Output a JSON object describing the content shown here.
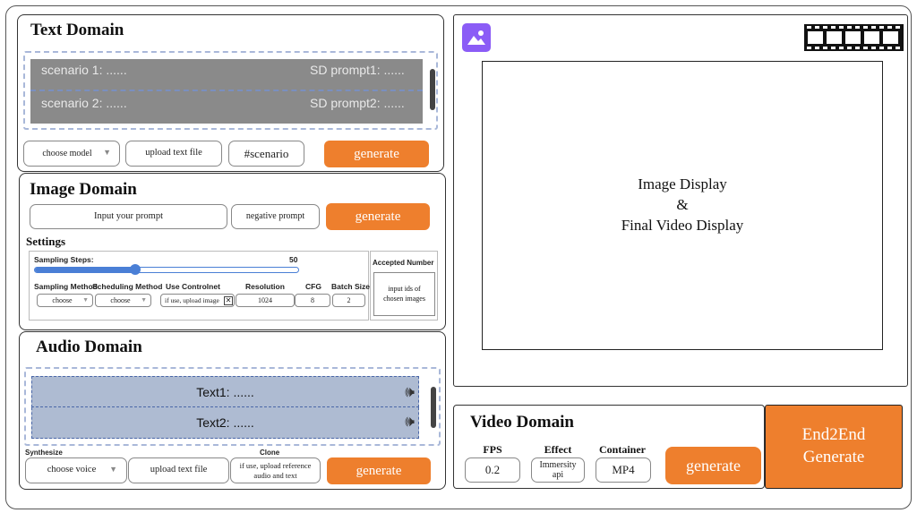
{
  "text_domain": {
    "title": "Text Domain",
    "rows": [
      {
        "scenario": "scenario 1: ......",
        "prompt": "SD prompt1: ......"
      },
      {
        "scenario": "scenario 2: ......",
        "prompt": "SD prompt2: ......"
      }
    ],
    "choose_model": "choose model",
    "upload": "upload text file",
    "scenario_field": "#scenario",
    "generate": "generate"
  },
  "image_domain": {
    "title": "Image Domain",
    "prompt_placeholder": "Input your prompt",
    "negative_placeholder": "negative prompt",
    "generate": "generate",
    "settings_title": "Settings",
    "sampling_steps_label": "Sampling Steps:",
    "sampling_steps_value": "50",
    "sampling_steps_fraction": 0.38,
    "columns": {
      "sampling_method": {
        "label": "Sampling Method",
        "value": "choose"
      },
      "scheduling_method": {
        "label": "Scheduling Method",
        "value": "choose"
      },
      "use_controlnet": {
        "label": "Use Controlnet",
        "value": "if use, upload image"
      },
      "resolution": {
        "label": "Resolution",
        "value": "1024"
      },
      "cfg": {
        "label": "CFG",
        "value": "8"
      },
      "batch_size": {
        "label": "Batch Size",
        "value": "2"
      }
    },
    "accepted_number_label": "Accepted Number",
    "accepted_number_placeholder": "input ids of chosen images"
  },
  "audio_domain": {
    "title": "Audio Domain",
    "rows": [
      "Text1: ......",
      "Text2: ......"
    ],
    "synthesize_label": "Synthesize",
    "choose_voice": "choose voice",
    "upload": "upload text file",
    "clone_label": "Clone",
    "clone_placeholder": "if use, upload reference audio and text",
    "generate": "generate"
  },
  "display": {
    "line1": "Image Display",
    "line2": "&",
    "line3": "Final Video Display"
  },
  "video_domain": {
    "title": "Video Domain",
    "fps_label": "FPS",
    "fps_value": "0.2",
    "effect_label": "Effect",
    "effect_value": "Immersity api",
    "container_label": "Container",
    "container_value": "MP4",
    "generate": "generate"
  },
  "end2end": {
    "line1": "End2End",
    "line2": "Generate"
  },
  "icons": {
    "image": "image-icon",
    "film": "film-strip-icon",
    "speaker": "speaker-icon",
    "dropdown": "chevron-down-icon",
    "close": "close-icon"
  },
  "colors": {
    "accent_orange": "#ee7f2d",
    "audio_row": "#aebbd2",
    "text_row": "#8a8a8a",
    "image_icon": "#8b5cf6"
  }
}
